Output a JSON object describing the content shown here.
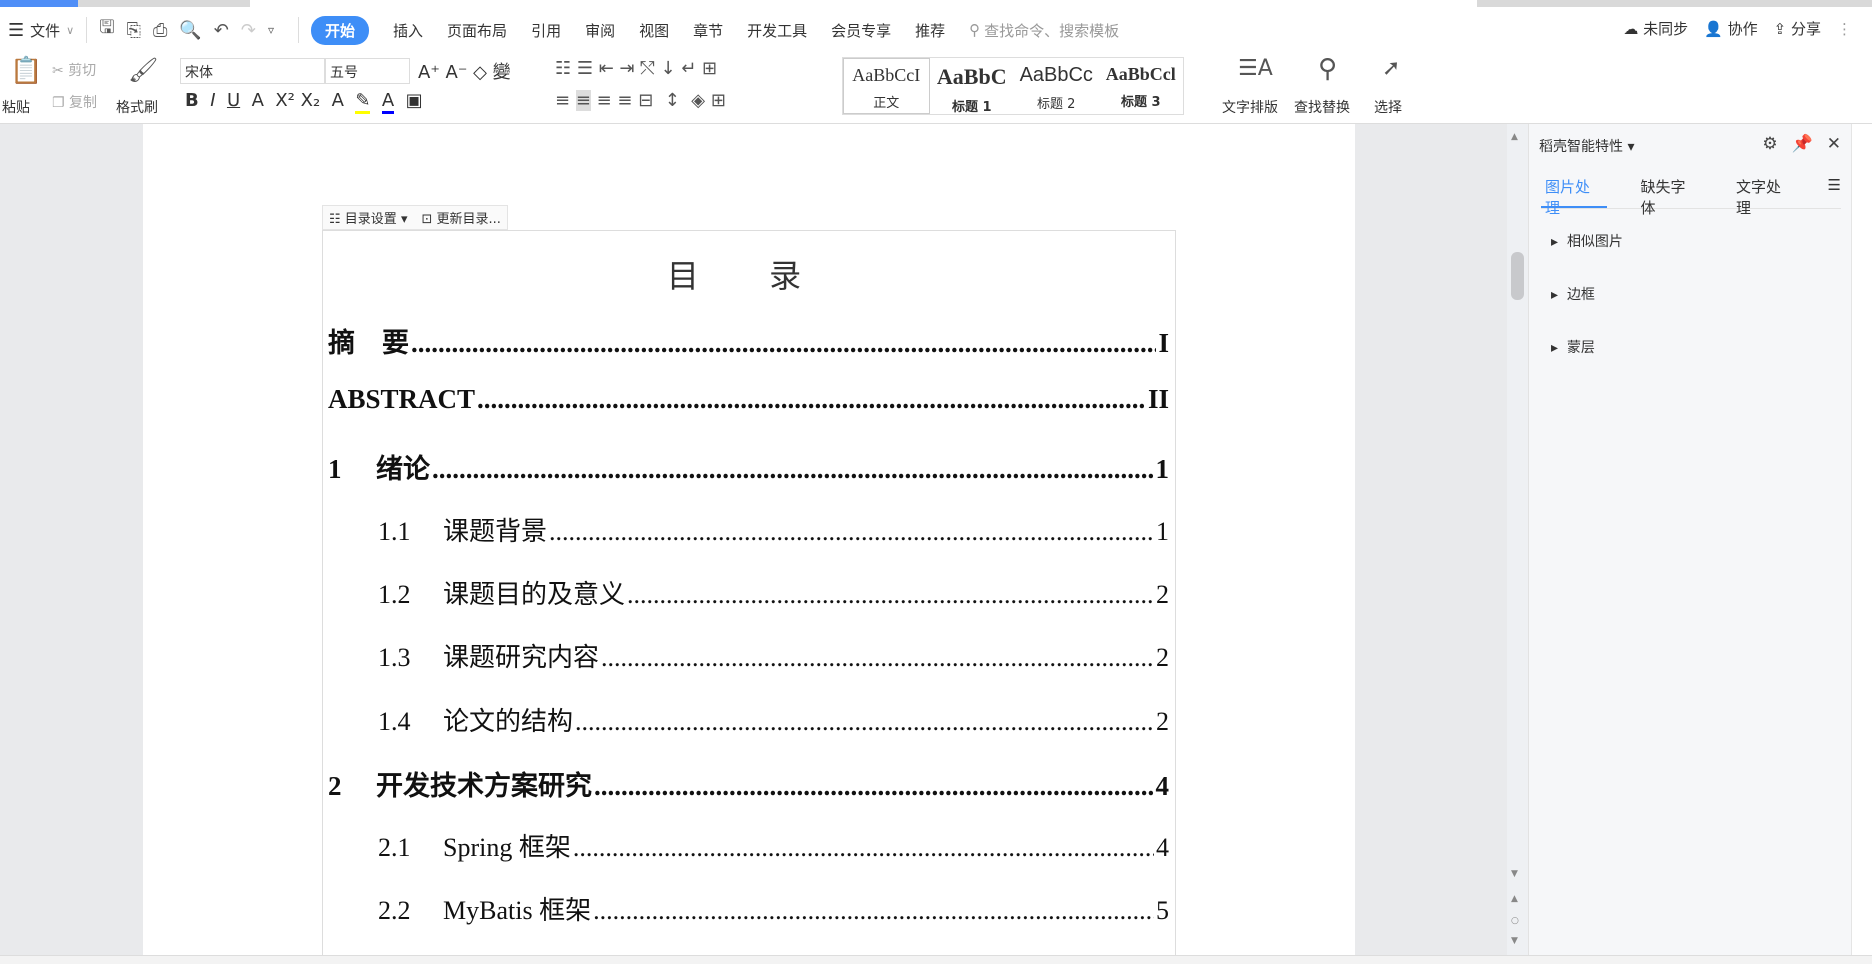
{
  "menu": {
    "file": "文件",
    "tabs": [
      "开始",
      "插入",
      "页面布局",
      "引用",
      "审阅",
      "视图",
      "章节",
      "开发工具",
      "会员专享",
      "推荐"
    ],
    "search_placeholder": "查找命令、搜索模板",
    "sync": "未同步",
    "collab": "协作",
    "share": "分享"
  },
  "ribbon": {
    "paste": "粘贴",
    "cut": "剪切",
    "copy": "复制",
    "format_painter": "格式刷",
    "font": "宋体",
    "size": "五号",
    "styles": [
      {
        "sample": "AaBbCcI",
        "name": "正文"
      },
      {
        "sample": "AaBbC",
        "name": "标题 1"
      },
      {
        "sample": "AaBbCc",
        "name": "标题 2"
      },
      {
        "sample": "AaBbCcl",
        "name": "标题 3"
      }
    ],
    "text_layout": "文字排版",
    "find_replace": "查找替换",
    "select": "选择"
  },
  "toc_toolbar": {
    "settings": "目录设置",
    "update": "更新目录..."
  },
  "toc": {
    "title": "目 录",
    "entries": [
      {
        "num": "摘　要",
        "text": "",
        "page": "I",
        "level": 1
      },
      {
        "num": "ABSTRACT",
        "text": "",
        "page": "II",
        "level": 1
      },
      {
        "num": "1",
        "text": "绪论",
        "page": "1",
        "level": 1
      },
      {
        "num": "1.1",
        "text": "课题背景",
        "page": "1",
        "level": 2
      },
      {
        "num": "1.2",
        "text": "课题目的及意义",
        "page": "2",
        "level": 2
      },
      {
        "num": "1.3",
        "text": "课题研究内容",
        "page": "2",
        "level": 2
      },
      {
        "num": "1.4",
        "text": "论文的结构",
        "page": "2",
        "level": 2
      },
      {
        "num": "2",
        "text": "开发技术方案研究",
        "page": "4",
        "level": 1
      },
      {
        "num": "2.1",
        "text": "Spring 框架",
        "page": "4",
        "level": 2
      },
      {
        "num": "2.2",
        "text": "MyBatis 框架",
        "page": "5",
        "level": 2
      }
    ]
  },
  "panel": {
    "title": "稻壳智能特性",
    "tabs": [
      "图片处理",
      "缺失字体",
      "文字处理"
    ],
    "items": [
      "相似图片",
      "边框",
      "蒙层"
    ]
  }
}
